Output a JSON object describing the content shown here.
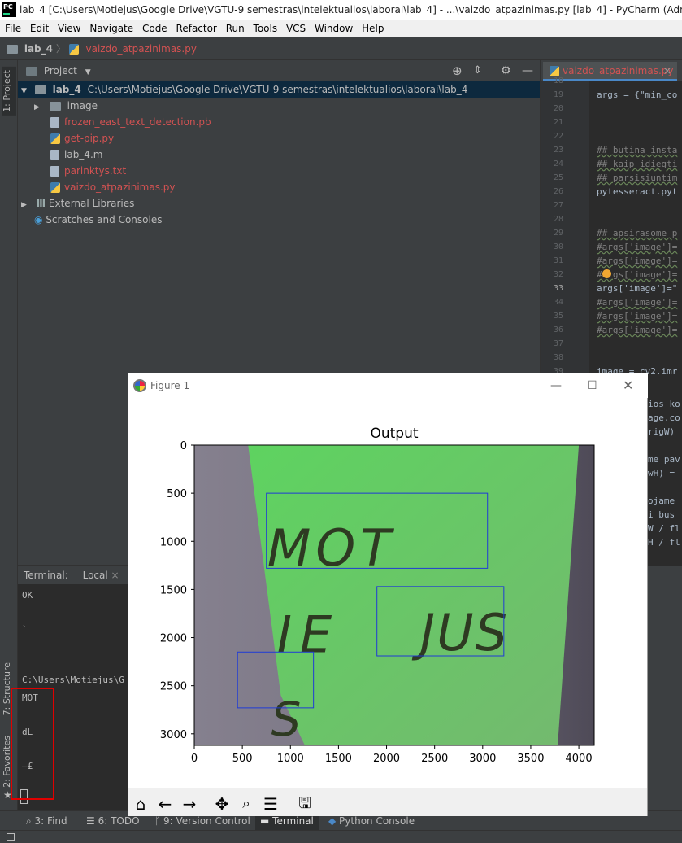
{
  "window": {
    "title": "lab_4 [C:\\Users\\Motiejus\\Google Drive\\VGTU-9 semestras\\intelektualios\\laborai\\lab_4] - ...\\vaizdo_atpazinimas.py [lab_4] - PyCharm (Administrator)",
    "logo": "PC"
  },
  "menu": [
    "File",
    "Edit",
    "View",
    "Navigate",
    "Code",
    "Refactor",
    "Run",
    "Tools",
    "VCS",
    "Window",
    "Help"
  ],
  "nav": {
    "project": "lab_4",
    "file": "vaizdo_atpazinimas.py"
  },
  "left_stripe": {
    "project_tab": "1: Project",
    "structure_tab": "7: Structure",
    "favorites_tab": "2: Favorites"
  },
  "project_panel": {
    "title": "Project",
    "root": {
      "name": "lab_4",
      "path": "C:\\Users\\Motiejus\\Google Drive\\VGTU-9 semestras\\intelektualios\\laborai\\lab_4"
    },
    "items": [
      {
        "name": "image",
        "kind": "folder"
      },
      {
        "name": "frozen_east_text_detection.pb",
        "kind": "file"
      },
      {
        "name": "get-pip.py",
        "kind": "py"
      },
      {
        "name": "lab_4.m",
        "kind": "file"
      },
      {
        "name": "parinktys.txt",
        "kind": "file"
      },
      {
        "name": "vaizdo_atpazinimas.py",
        "kind": "py"
      }
    ],
    "external": "External Libraries",
    "scratches": "Scratches and Consoles"
  },
  "editor": {
    "tab": "vaizdo_atpazinimas.py",
    "lines": [
      {
        "n": "18",
        "t": ""
      },
      {
        "n": "19",
        "t": "args = {\"min_co"
      },
      {
        "n": "20",
        "t": ""
      },
      {
        "n": "21",
        "t": ""
      },
      {
        "n": "22",
        "t": ""
      },
      {
        "n": "23",
        "t": "## butina insta"
      },
      {
        "n": "24",
        "t": "## kaip idiegti"
      },
      {
        "n": "25",
        "t": "## parsisiuntim"
      },
      {
        "n": "26",
        "t": "pytesseract.pyt"
      },
      {
        "n": "27",
        "t": ""
      },
      {
        "n": "28",
        "t": ""
      },
      {
        "n": "29",
        "t": "## apsirasome p"
      },
      {
        "n": "30",
        "t": "#args['image']="
      },
      {
        "n": "31",
        "t": "#args['image']="
      },
      {
        "n": "32",
        "t": "#args['image']="
      },
      {
        "n": "33",
        "t": "args['image']=\""
      },
      {
        "n": "34",
        "t": "#args['image']="
      },
      {
        "n": "35",
        "t": "#args['image']="
      },
      {
        "n": "36",
        "t": "#args['image']="
      },
      {
        "n": "37",
        "t": ""
      },
      {
        "n": "38",
        "t": ""
      },
      {
        "n": "39",
        "t": "image = cv2.imr"
      }
    ],
    "partial": [
      "ios ko",
      "age.co",
      "rigW)",
      "me pav",
      "wH) =",
      "ojame",
      "i bus",
      "W / fl",
      "H / fl"
    ]
  },
  "terminal": {
    "label": "Terminal:",
    "tab": "Local",
    "lines": [
      "OK",
      "`",
      "C:\\Users\\Motiejus\\G",
      "MOT",
      "dL",
      "—£"
    ]
  },
  "bottom_tabs": [
    "3: Find",
    "6: TODO",
    "9: Version Control",
    "Terminal",
    "Python Console"
  ],
  "figure": {
    "window_title": "Figure 1",
    "toolbar": [
      "home-icon",
      "back-icon",
      "forward-icon",
      "pan-icon",
      "zoom-icon",
      "configure-icon",
      "save-icon"
    ]
  },
  "chart_data": {
    "type": "image",
    "title": "Output",
    "xlim": [
      0,
      4160
    ],
    "ylim": [
      3120,
      0
    ],
    "xticks": [
      0,
      500,
      1000,
      1500,
      2000,
      2500,
      3000,
      3500,
      4000
    ],
    "yticks": [
      0,
      500,
      1000,
      1500,
      2000,
      2500,
      3000
    ],
    "boxes": [
      {
        "x1": 750,
        "y1": 500,
        "x2": 3050,
        "y2": 1280
      },
      {
        "x1": 1900,
        "y1": 1470,
        "x2": 3220,
        "y2": 2190
      },
      {
        "x1": 450,
        "y1": 2150,
        "x2": 1240,
        "y2": 2730
      }
    ],
    "image_text": [
      "MOT",
      "IE",
      "JUS",
      "S"
    ],
    "colors": {
      "paper": "#6cc46a",
      "box": "#1f3bd6",
      "ink": "#2e3a22",
      "background": "#7a7584"
    }
  }
}
